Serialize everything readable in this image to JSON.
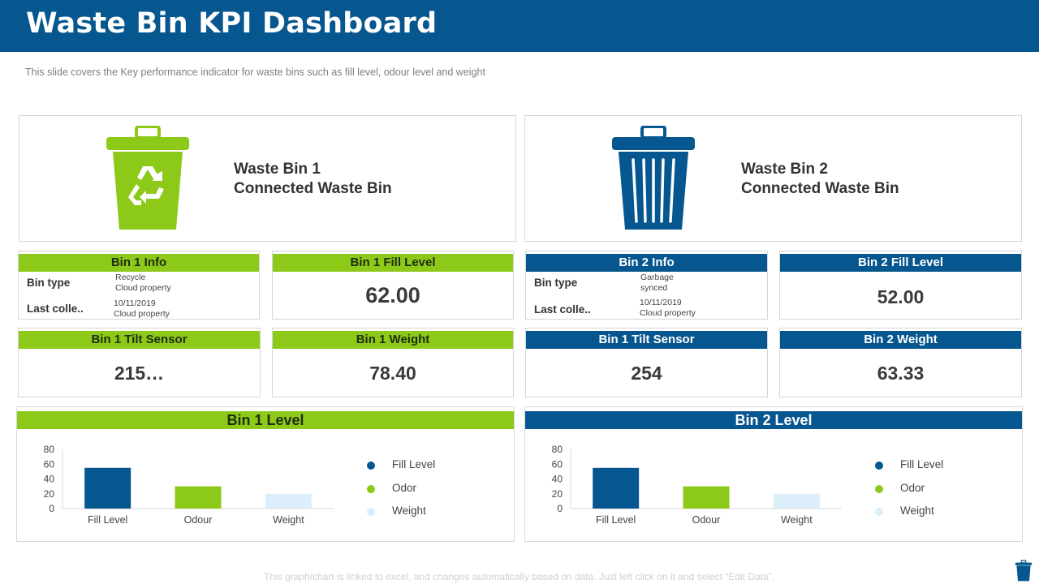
{
  "title": "Waste Bin KPI Dashboard",
  "subtitle": "This slide covers the Key performance  indicator for waste bins such as fill level,  odour level  and weight",
  "colors": {
    "header": "#06568f",
    "green": "#8cc919",
    "blue": "#06568f",
    "light_blue": "#ddeefb"
  },
  "bin1": {
    "icon": "recycle-bin-icon",
    "name": "Waste Bin 1",
    "desc": "Connected Waste Bin",
    "info": {
      "title": "Bin 1 Info",
      "type_label": "Bin type",
      "type_line1": "Recycle",
      "type_line2": "Cloud property",
      "last_label": "Last colle..",
      "last_line1": "10/11/2019",
      "last_line2": "Cloud property"
    },
    "fill": {
      "title": "Bin 1 Fill Level",
      "value": "62.00"
    },
    "tilt": {
      "title": "Bin 1 Tilt Sensor",
      "value": "215…"
    },
    "weight": {
      "title": "Bin 1 Weight",
      "value": "78.40"
    }
  },
  "bin2": {
    "icon": "trash-bin-icon",
    "name": "Waste Bin 2",
    "desc": "Connected Waste Bin",
    "info": {
      "title": "Bin 2 Info",
      "type_label": "Bin type",
      "type_line1": "Garbage",
      "type_line2": "synced",
      "last_label": "Last colle..",
      "last_line1": "10/11/2019",
      "last_line2": "Cloud property"
    },
    "fill": {
      "title": "Bin 2 Fill Level",
      "value": "52.00"
    },
    "tilt": {
      "title": "Bin 1 Tilt Sensor",
      "value": "254"
    },
    "weight": {
      "title": "Bin 2 Weight",
      "value": "63.33"
    }
  },
  "chart_data": [
    {
      "type": "bar",
      "title": "Bin 1 Level",
      "categories": [
        "Fill Level",
        "Odour",
        "Weight"
      ],
      "values": [
        55,
        30,
        20
      ],
      "bar_colors": [
        "#06568f",
        "#8cc919",
        "#ddeefb"
      ],
      "yticks": [
        "80",
        "60",
        "40",
        "20",
        "0"
      ],
      "ylim": [
        0,
        80
      ],
      "legend": [
        "Fill Level",
        "Odor",
        "Weight"
      ],
      "legend_position": "right",
      "grid": false
    },
    {
      "type": "bar",
      "title": "Bin 2 Level",
      "categories": [
        "Fill Level",
        "Odour",
        "Weight"
      ],
      "values": [
        55,
        30,
        20
      ],
      "bar_colors": [
        "#06568f",
        "#8cc919",
        "#ddeefb"
      ],
      "yticks": [
        "80",
        "60",
        "40",
        "20",
        "0"
      ],
      "ylim": [
        0,
        80
      ],
      "legend": [
        "Fill Level",
        "Odor",
        "Weight"
      ],
      "legend_position": "right",
      "grid": false
    }
  ],
  "footer": "This graph/chart is linked to excel, and changes automatically based on data. Just left click on it and select “Edit Data”.",
  "corner_icon": "trash-bin-icon"
}
